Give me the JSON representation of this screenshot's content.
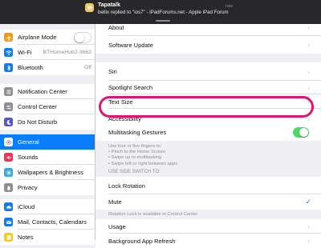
{
  "notification": {
    "app": "Tapatalk",
    "message": "bellix replied to \"ios7\" - iPadForums.net - Apple iPad Forum",
    "time": "now",
    "icon": "tapatalk-icon"
  },
  "sidebar": {
    "groups": [
      [
        {
          "label": "Airplane Mode",
          "icon": "airplane-icon",
          "color": "#ff9500",
          "control": "toggle",
          "on": false
        },
        {
          "label": "Wi-Fi",
          "value": "BTHomeHub2-3662",
          "icon": "wifi-icon",
          "color": "#0a7dfd"
        },
        {
          "label": "Bluetooth",
          "value": "Off",
          "icon": "bluetooth-icon",
          "color": "#0a7dfd"
        }
      ],
      [
        {
          "label": "Notification Center",
          "icon": "notification-center-icon",
          "color": "#8e8e93"
        },
        {
          "label": "Control Center",
          "icon": "control-center-icon",
          "color": "#8e8e93"
        },
        {
          "label": "Do Not Disturb",
          "icon": "moon-icon",
          "color": "#5856d6"
        }
      ],
      [
        {
          "label": "General",
          "icon": "gear-icon",
          "color": "#8e8e93",
          "selected": true
        },
        {
          "label": "Sounds",
          "icon": "sounds-icon",
          "color": "#ff2d55"
        },
        {
          "label": "Wallpapers & Brightness",
          "icon": "wallpaper-icon",
          "color": "#34aadc"
        },
        {
          "label": "Privacy",
          "icon": "hand-icon",
          "color": "#8e8e93"
        }
      ],
      [
        {
          "label": "iCloud",
          "icon": "cloud-icon",
          "color": "#0a7dfd"
        },
        {
          "label": "Mail, Contacts, Calendars",
          "icon": "mail-icon",
          "color": "#0a7dfd"
        },
        {
          "label": "Notes",
          "icon": "notes-icon",
          "color": "#ffcc00"
        }
      ]
    ]
  },
  "main": {
    "group1": [
      "About",
      "Software Update"
    ],
    "group2": [
      "Siri",
      "Spotlight Search",
      "Text Size",
      "Accessibility"
    ],
    "multitasking": {
      "label": "Multitasking Gestures",
      "on": true,
      "footer": [
        "Use four or five fingers to:",
        "• Pinch to the Home Screen",
        "• Swipe up to multitasking",
        "• Swipe left or right between apps"
      ]
    },
    "side_switch": {
      "header": "USE SIDE SWITCH TO:",
      "options": [
        {
          "label": "Lock Rotation",
          "checked": false
        },
        {
          "label": "Mute",
          "checked": true
        }
      ],
      "footer": "Rotation Lock is available in Control Center."
    },
    "group4": [
      "Usage",
      "Background App Refresh"
    ]
  },
  "colors": {
    "accent": "#0a7dfd",
    "toggle_on": "#4cd964",
    "highlight": "#e0166e"
  }
}
